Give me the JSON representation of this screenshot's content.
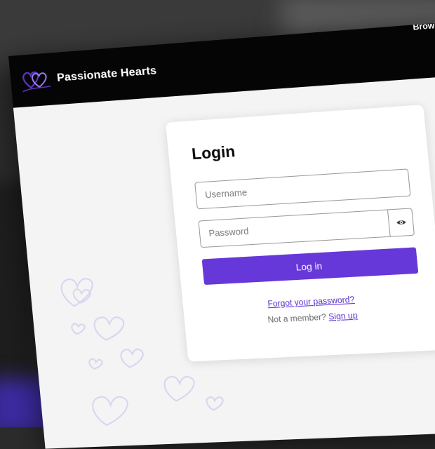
{
  "navbar": {
    "brand_name": "Passionate Hearts",
    "links": [
      {
        "label": "Browse"
      }
    ]
  },
  "login": {
    "title": "Login",
    "username_placeholder": "Username",
    "password_placeholder": "Password",
    "submit_label": "Log in",
    "forgot_password_label": "Forgot your password?",
    "not_member_text": "Not a member?",
    "signup_label": "Sign up"
  },
  "icons": {
    "logo": "interlocked-hearts-icon",
    "password_toggle": "eye-icon",
    "background": "heart-outline-icon"
  },
  "colors": {
    "navbar_bg": "#050505",
    "accent": "#6637d9",
    "link": "#5b2fd0",
    "page_bg": "#f4f4f5"
  }
}
